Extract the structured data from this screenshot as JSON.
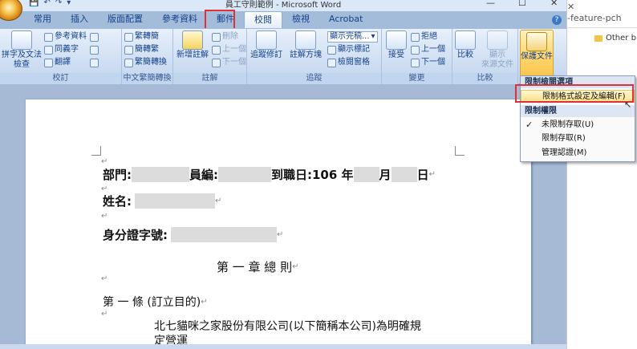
{
  "window": {
    "title": "員工守則範例 - Microsoft Word"
  },
  "qat": {
    "save": "💾",
    "undo": "↶",
    "redo": "↷",
    "more": "▾"
  },
  "tabs": [
    "常用",
    "插入",
    "版面配置",
    "參考資料",
    "郵件",
    "校閱",
    "檢視",
    "Acrobat"
  ],
  "active_tab": "校閱",
  "ribbon": {
    "proofing": {
      "label": "校訂",
      "spell": "拼字及文法\n檢查",
      "research": "參考資料",
      "thesaurus": "同義字",
      "translate": "翻譯"
    },
    "chinese": {
      "label": "中文繁簡轉換",
      "trad_to_simp": "繁轉簡",
      "simp_to_trad": "簡轉繁",
      "convert": "繁簡轉換"
    },
    "comments": {
      "label": "註解",
      "new_comment": "新增註解",
      "delete": "刪除",
      "prev": "上一個",
      "next": "下一個"
    },
    "tracking": {
      "label": "追蹤",
      "track_changes": "追蹤修訂",
      "balloons": "註解方塊",
      "display_value": "顯示完稿...",
      "show_markup": "顯示標記",
      "reviewing_pane": "檢閱窗格"
    },
    "changes": {
      "label": "變更",
      "accept": "接受",
      "reject": "拒絕",
      "prev": "上一個",
      "next": "下一個"
    },
    "compare": {
      "label": "比較",
      "compare": "比較",
      "show_source": "顯示\n來源文件"
    },
    "protect": {
      "label": "保護文件"
    }
  },
  "document": {
    "line1": {
      "dept": "部門:",
      "emp_id": "員編:",
      "hire": "到職日:",
      "year": "106 年",
      "month": "月",
      "day": "日"
    },
    "line2": {
      "name": "姓名:"
    },
    "line3": {
      "idno": "身分證字號:"
    },
    "chapter": "第 一 章 總   則",
    "article": "第  一  條  (訂立目的)",
    "body": "北七貓咪之家股份有限公司(以下簡稱本公司)為明確規",
    "body2": "定營運"
  },
  "menu": {
    "header1": "限制檢閱選項",
    "item_format": "限制格式設定及編輯(F)",
    "header2": "限制權限",
    "item_unrestricted": "未限制存取(U)",
    "item_restricted": "限制存取(R)",
    "item_manage": "管理認證(M)"
  },
  "browser": {
    "tab_text": "-feature-pch",
    "bookmark": "Other b",
    "close": "✕"
  },
  "colors": {
    "highlight": "#e0303a",
    "ribbon": "#cfdff2"
  }
}
